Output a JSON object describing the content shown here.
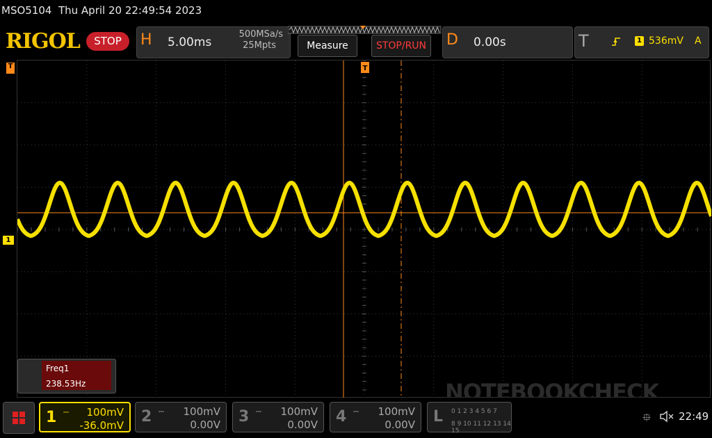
{
  "title": "MSO5104  Thu April 20 22:49:54 2023",
  "brand": "RIGOL",
  "run_state": "STOP",
  "horizontal": {
    "letter": "H",
    "scale": "5.00ms",
    "sample_rate": "500MSa/s",
    "memory_depth": "25Mpts"
  },
  "buttons": {
    "measure": "Measure",
    "stop_run": "STOP/RUN"
  },
  "delay": {
    "letter": "D",
    "value": "0.00s"
  },
  "trigger": {
    "letter": "T",
    "source": "1",
    "level": "536mV",
    "mode": "A"
  },
  "measurement": {
    "label": "Freq1",
    "value": "238.53Hz"
  },
  "channels": [
    {
      "num": "1",
      "scale": "100mV",
      "offset": "-36.0mV",
      "active": true
    },
    {
      "num": "2",
      "scale": "100mV",
      "offset": "0.00V",
      "active": false
    },
    {
      "num": "3",
      "scale": "100mV",
      "offset": "0.00V",
      "active": false
    },
    {
      "num": "4",
      "scale": "100mV",
      "offset": "0.00V",
      "active": false
    }
  ],
  "logic": {
    "letter": "L",
    "row1": "0 1 2 3 4 5 6 7",
    "row2": "8 9 10 11 12 13 14 15"
  },
  "clock": "22:49",
  "watermark": "NOTEBOOKCHECK",
  "ch1_marker": "1",
  "trigger_marker": "T",
  "colors": {
    "ch1": "#f5e000",
    "accent": "#ff8a1a",
    "stop": "#c8202a"
  }
}
